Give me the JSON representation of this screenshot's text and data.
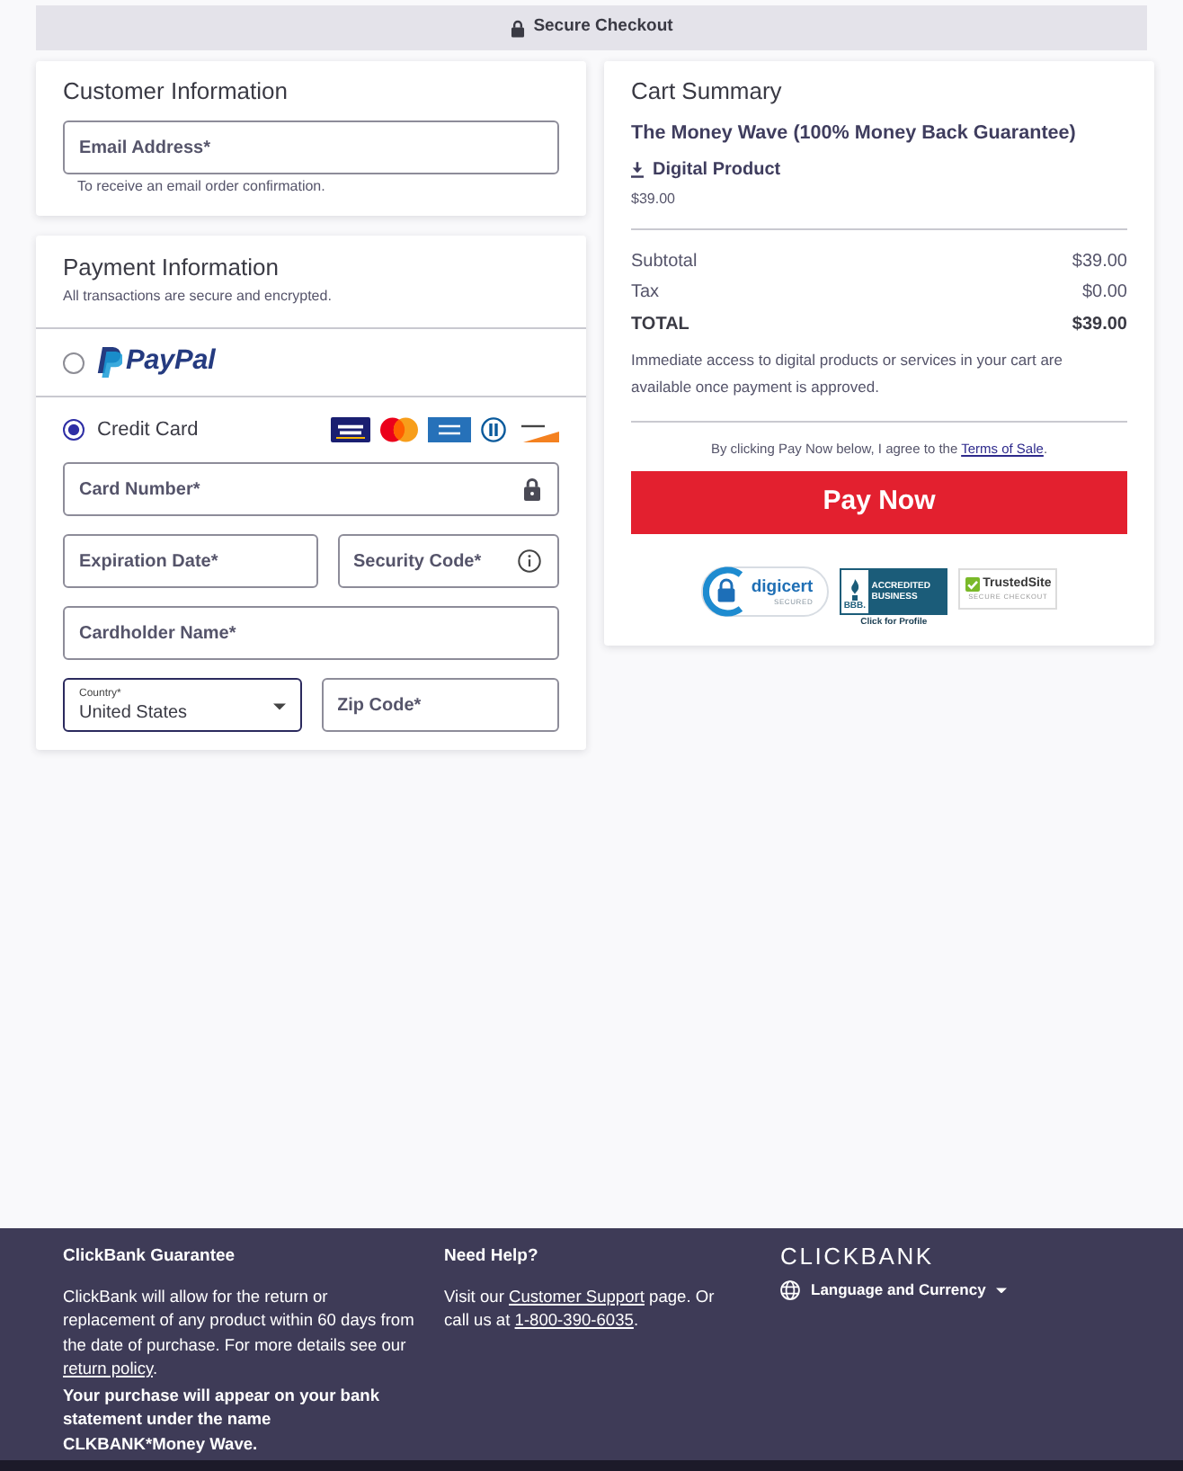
{
  "top_bar": {
    "title": "Secure Checkout"
  },
  "customer_information": {
    "title": "Customer Information",
    "email": {
      "placeholder": "Email Address*",
      "focused": false,
      "hint": "To receive an email order confirmation."
    }
  },
  "payment_information": {
    "title": "Payment Information",
    "subtitle": "All transactions are secure and encrypted.",
    "methods": [
      {
        "kind": "paypal",
        "label": "PayPal",
        "selected": false
      },
      {
        "kind": "card",
        "label": "Credit Card",
        "selected": true,
        "brands": [
          {
            "kind": "visa"
          },
          {
            "kind": "mastercard"
          },
          {
            "kind": "amex"
          },
          {
            "kind": "diners"
          },
          {
            "kind": "discover"
          }
        ]
      }
    ],
    "fields": [
      [
        {
          "kind": "secure",
          "placeholder": "Card Number*",
          "focused": false
        }
      ],
      [
        {
          "kind": "text",
          "placeholder": "Expiration Date*",
          "focused": false
        },
        {
          "kind": "help",
          "placeholder": "Security Code*",
          "focused": false
        }
      ],
      [
        {
          "kind": "text",
          "placeholder": "Cardholder Name*",
          "focused": false
        }
      ],
      [
        {
          "kind": "select",
          "label": "Country*",
          "value": "United States",
          "focused": true
        },
        {
          "kind": "text",
          "placeholder": "Zip Code*",
          "focused": false
        }
      ]
    ]
  },
  "cart_summary": {
    "title": "Cart Summary",
    "product": {
      "name": "The Money Wave (100% Money Back Guarantee)",
      "type": "Digital Product",
      "price": "$39.00"
    },
    "totals": [
      {
        "kind": "line",
        "label": "Subtotal",
        "value": "$39.00"
      },
      {
        "kind": "line",
        "label": "Tax",
        "value": "$0.00"
      },
      {
        "kind": "total",
        "label": "TOTAL",
        "value": "$39.00"
      }
    ],
    "note": "Immediate access to digital products or services in your cart are available once payment is approved.",
    "agreement": [
      {
        "text": "By clicking Pay Now below, I agree to the "
      },
      {
        "link": "Terms of Sale"
      },
      {
        "text": "."
      }
    ],
    "pay_button": "Pay Now",
    "badges": [
      {
        "kind": "digicert",
        "title": "digicert",
        "subtitle": "SECURED"
      },
      {
        "kind": "bbb",
        "logo": "BBB.",
        "title": "ACCREDITED BUSINESS",
        "caption": "Click for Profile"
      },
      {
        "kind": "trustedsite",
        "title": "TrustedSite",
        "subtitle": "SECURE CHECKOUT"
      }
    ]
  },
  "footer": {
    "columns": [
      {
        "kind": "text",
        "title": "ClickBank Guarantee",
        "paragraphs": [
          {
            "bold": false,
            "parts": [
              {
                "text": "ClickBank will allow for the return or replacement of any product within 60 days from the date of purchase. For more details see our "
              },
              {
                "link": "return policy"
              },
              {
                "text": "."
              }
            ]
          },
          {
            "bold": true,
            "parts": [
              {
                "text": "Your purchase will appear on your bank statement under the name CLKBANK*Money Wave."
              }
            ]
          }
        ]
      },
      {
        "kind": "text",
        "title": "Need Help?",
        "paragraphs": [
          {
            "bold": false,
            "parts": [
              {
                "text": "Visit our "
              },
              {
                "link": "Customer Support"
              },
              {
                "text": " page. Or call us at "
              },
              {
                "link": "1-800-390-6035"
              },
              {
                "text": "."
              }
            ]
          }
        ]
      },
      {
        "kind": "brand",
        "logo": "CLICKBANK",
        "menu": "Language and Currency"
      }
    ]
  }
}
